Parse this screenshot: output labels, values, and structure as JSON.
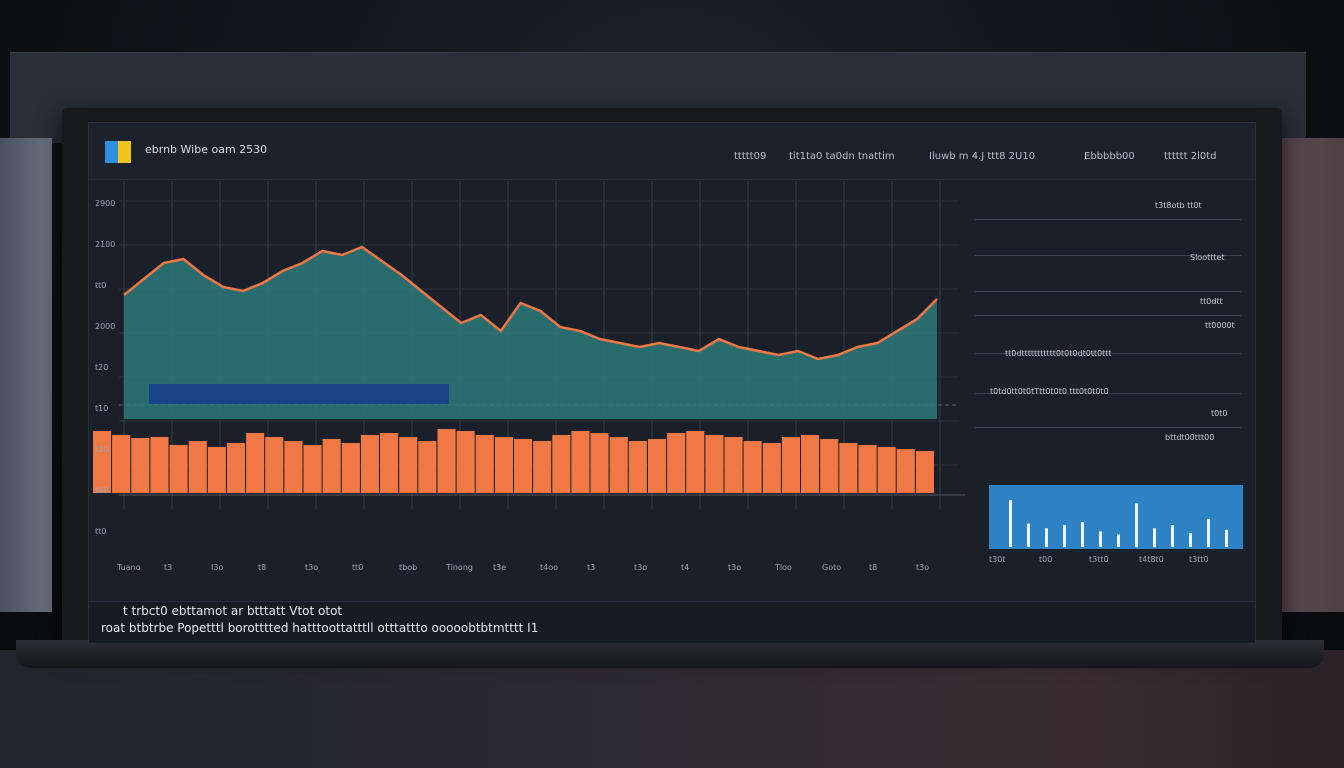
{
  "topbar": {
    "title": "ebrnb   Wibe oam 2530",
    "items": [
      "ttttt09",
      "tit1ta0 ta0dn tnattim",
      "Iluwb m 4.J ttt8 2U10",
      "Ebbbbb00",
      "tttttt 2l0td"
    ]
  },
  "yaxis": {
    "labels": [
      "2900",
      "2100",
      "tt0",
      "2000",
      "t20",
      "t10",
      "t20",
      "t60",
      "tt0"
    ]
  },
  "xaxis": {
    "labels": [
      "Tuano",
      "t3",
      "I3o",
      "t8",
      "t3o",
      "tt0",
      "tbob",
      "Tinong",
      "t3e",
      "t4oo",
      "t3",
      "t3o",
      "t4",
      "t3o",
      "Tloo",
      "Goto",
      "t8",
      "t3o"
    ]
  },
  "right_panel": {
    "labels": [
      "t3t8otb tt0t",
      "Slootttet",
      "tt0dtt",
      "tt0000t",
      "tt0dttttttttttt0t0t0dt0tt0ttt",
      "t0td0tt0t0tTtt0t0t0 ttt0t0t0t0",
      "t0t0",
      "bttdt00ttt00"
    ],
    "mini_labels": [
      "t30t",
      "t00",
      "t3tt0",
      "t4t8t0",
      "t3tt0"
    ]
  },
  "footer": {
    "line1": "t trbct0 ebttamot ar  btttatt Vtot otot",
    "line2": "roat btbtrbe Popetttl borotttted  hatttoottatttll  otttattto ooooobtbtmtttt I1"
  },
  "colors": {
    "accent": "#f07845",
    "series_area": "#2b7a7a",
    "series_band": "#1a3f8a",
    "bars": "#f07845"
  },
  "chart_data": [
    {
      "type": "area",
      "series": [
        {
          "values": [
            62,
            70,
            78,
            80,
            72,
            66,
            64,
            68,
            74,
            78,
            84,
            82,
            86,
            79,
            72,
            64,
            56,
            48,
            52,
            44,
            58,
            54,
            46,
            44,
            40,
            38,
            36,
            38,
            36,
            34,
            40,
            36,
            34,
            32,
            34,
            30,
            32,
            36,
            38,
            44,
            50,
            60
          ]
        }
      ]
    },
    {
      "type": "bar",
      "values": [
        62,
        58,
        55,
        56,
        48,
        52,
        46,
        50,
        60,
        56,
        52,
        48,
        54,
        50,
        58,
        60,
        56,
        52,
        64,
        62,
        58,
        56,
        54,
        52,
        58,
        62,
        60,
        56,
        52,
        54,
        60,
        62,
        58,
        56,
        52,
        50,
        56,
        58,
        54,
        50,
        48,
        46,
        44,
        42
      ]
    },
    {
      "type": "bar",
      "values": [
        30,
        15,
        12,
        14,
        16,
        10,
        8,
        28,
        12,
        14,
        9,
        18,
        11
      ]
    }
  ]
}
